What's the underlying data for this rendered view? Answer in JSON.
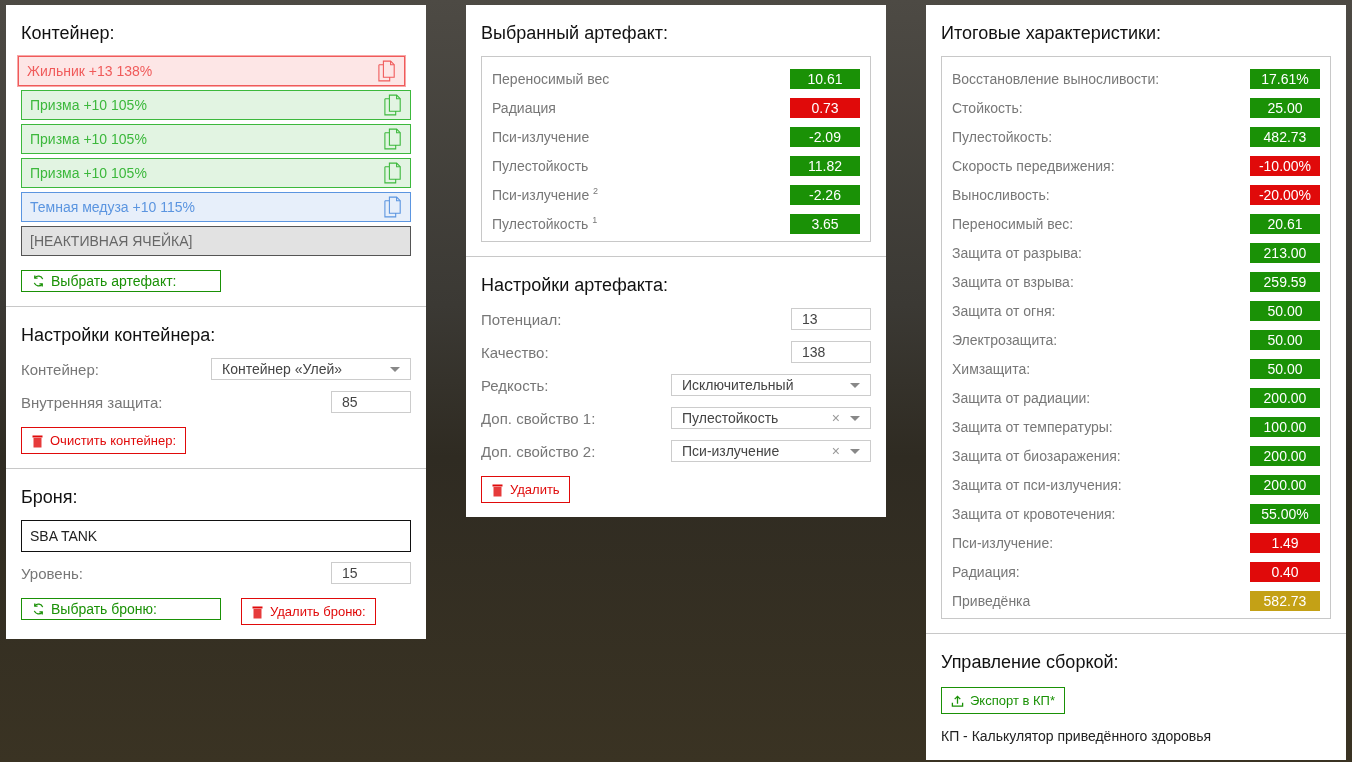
{
  "container": {
    "title": "Контейнер:",
    "slots": [
      {
        "kind": "artifact",
        "label": "Жильник +13 138%",
        "color": "#f05a5a",
        "selected": true
      },
      {
        "kind": "artifact",
        "label": "Призма +10 105%",
        "color": "#3cb83c",
        "selected": false
      },
      {
        "kind": "artifact",
        "label": "Призма +10 105%",
        "color": "#3cb83c",
        "selected": false
      },
      {
        "kind": "artifact",
        "label": "Призма +10 105%",
        "color": "#3cb83c",
        "selected": false
      },
      {
        "kind": "artifact",
        "label": "Темная медуза +10 115%",
        "color": "#5b95e0",
        "selected": false
      },
      {
        "kind": "inactive",
        "label": "[НЕАКТИВНАЯ ЯЧЕЙКА]",
        "color": "#555555",
        "selected": false
      }
    ],
    "button": {
      "kind": "select",
      "label": "Выбрать артефакт:"
    }
  },
  "container_settings": {
    "title": "Настройки контейнера:",
    "fields": [
      {
        "kind": "select",
        "label": "Контейнер:",
        "value": "Контейнер «Улей»"
      },
      {
        "kind": "number",
        "label": "Внутренняя защита:",
        "value": "85"
      }
    ],
    "button": {
      "kind": "delete",
      "label": "Очистить контейнер:"
    }
  },
  "armor": {
    "title": "Броня:",
    "name": "SBA TANK",
    "fields": [
      {
        "kind": "number",
        "label": "Уровень:",
        "value": "15"
      }
    ],
    "buttons": [
      {
        "kind": "select",
        "label": "Выбрать броню:"
      },
      {
        "kind": "delete",
        "label": "Удалить броню:"
      }
    ]
  },
  "selected_artifact": {
    "title": "Выбранный артефакт:",
    "stats": [
      {
        "label": "Переносимый вес",
        "value": "10.61",
        "color": "#1a9106"
      },
      {
        "label": "Радиация",
        "value": "0.73",
        "color": "#e00a0a"
      },
      {
        "label": "Пси-излучение",
        "value": "-2.09",
        "color": "#1a9106"
      },
      {
        "label": "Пулестойкость",
        "value": "11.82",
        "color": "#1a9106"
      },
      {
        "label": "Пси-излучение $^{2}$",
        "value": "-2.26",
        "color": "#1a9106"
      },
      {
        "label": "Пулестойкость $^{1}$",
        "value": "3.65",
        "color": "#1a9106"
      }
    ]
  },
  "artifact_settings": {
    "title": "Настройки артефакта:",
    "fields": [
      {
        "kind": "number",
        "label": "Потенциал:",
        "value": "13"
      },
      {
        "kind": "number",
        "label": "Качество:",
        "value": "138"
      },
      {
        "kind": "select",
        "label": "Редкость:",
        "value": "Исключительный"
      },
      {
        "kind": "select",
        "label": "Доп. свойство 1:",
        "value": "Пулестойкость",
        "clear": "×"
      },
      {
        "kind": "select",
        "label": "Доп. свойство 2:",
        "value": "Пси-излучение",
        "clear": "×"
      }
    ],
    "button": {
      "kind": "delete",
      "label": "Удалить"
    }
  },
  "totals": {
    "title": "Итоговые характеристики:",
    "stats": [
      {
        "label": "Восстановление выносливости:",
        "value": "17.61%",
        "color": "#1a9106"
      },
      {
        "label": "Стойкость:",
        "value": "25.00",
        "color": "#1a9106"
      },
      {
        "label": "Пулестойкость:",
        "value": "482.73",
        "color": "#1a9106"
      },
      {
        "label": "Скорость передвижения:",
        "value": "-10.00%",
        "color": "#e00a0a"
      },
      {
        "label": "Выносливость:",
        "value": "-20.00%",
        "color": "#e00a0a"
      },
      {
        "label": "Переносимый вес:",
        "value": "20.61",
        "color": "#1a9106"
      },
      {
        "label": "Защита от разрыва:",
        "value": "213.00",
        "color": "#1a9106"
      },
      {
        "label": "Защита от взрыва:",
        "value": "259.59",
        "color": "#1a9106"
      },
      {
        "label": "Защита от огня:",
        "value": "50.00",
        "color": "#1a9106"
      },
      {
        "label": "Электрозащита:",
        "value": "50.00",
        "color": "#1a9106"
      },
      {
        "label": "Химзащита:",
        "value": "50.00",
        "color": "#1a9106"
      },
      {
        "label": "Защита от радиации:",
        "value": "200.00",
        "color": "#1a9106"
      },
      {
        "label": "Защита от температуры:",
        "value": "100.00",
        "color": "#1a9106"
      },
      {
        "label": "Защита от биозаражения:",
        "value": "200.00",
        "color": "#1a9106"
      },
      {
        "label": "Защита от пси-излучения:",
        "value": "200.00",
        "color": "#1a9106"
      },
      {
        "label": "Защита от кровотечения:",
        "value": "55.00%",
        "color": "#1a9106"
      },
      {
        "label": "Пси-излучение:",
        "value": "1.49",
        "color": "#e00a0a"
      },
      {
        "label": "Радиация:",
        "value": "0.40",
        "color": "#e00a0a"
      },
      {
        "label": "Приведёнка",
        "value": "582.73",
        "color": "#c4a116"
      }
    ]
  },
  "build": {
    "title": "Управление сборкой:",
    "button": {
      "kind": "export",
      "label": "Экспорт в КП*"
    },
    "note": "КП - Калькулятор приведённого здоровья"
  }
}
